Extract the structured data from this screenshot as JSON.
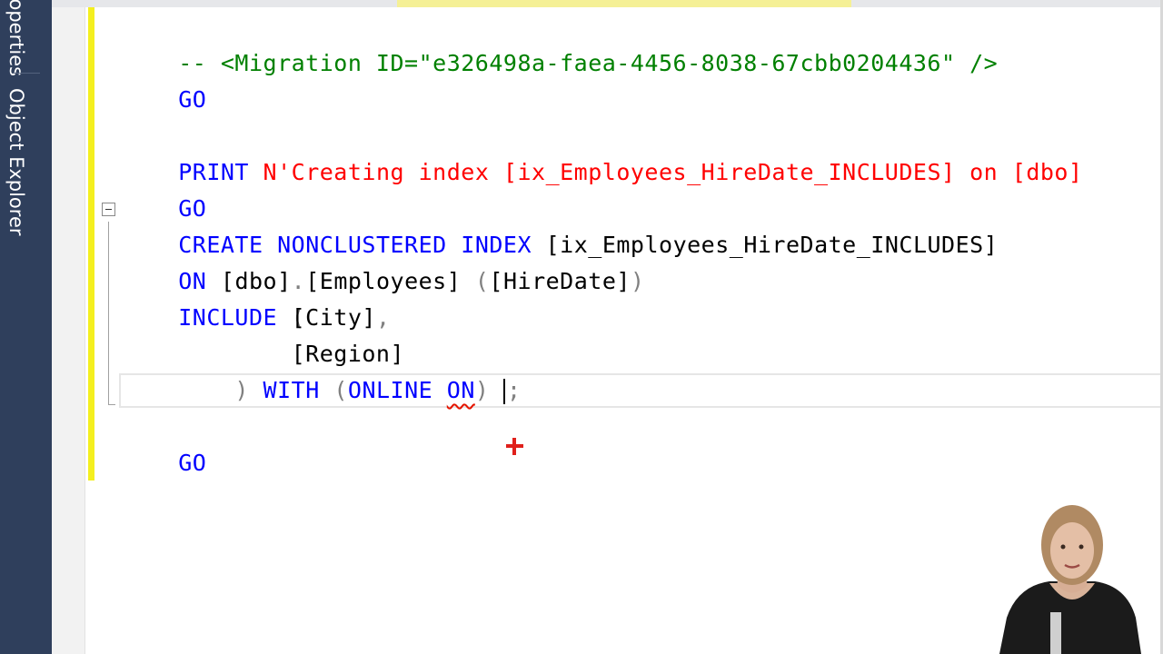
{
  "sidebar": {
    "tabs": [
      {
        "label": "Properties"
      },
      {
        "label": "Object Explorer"
      }
    ]
  },
  "editor": {
    "lines": {
      "l1": {
        "comment": "-- <Migration ID=\"e326498a-faea-4456-8038-67cbb0204436\" />"
      },
      "l2": {
        "go": "GO"
      },
      "l4": {
        "print_kw": "PRINT",
        "print_str": "N'Creating index [ix_Employees_HireDate_INCLUDES] on [dbo]"
      },
      "l5": {
        "go": "GO"
      },
      "l6": {
        "create": "CREATE",
        "nonclustered": "NONCLUSTERED",
        "index": "INDEX",
        "name": "[ix_Employees_HireDate_INCLUDES]"
      },
      "l7": {
        "on": "ON",
        "schema": "[dbo]",
        "dot": ".",
        "table": "[Employees]",
        "open": "(",
        "col": "[HireDate]",
        "close": ")"
      },
      "l8": {
        "include": "INCLUDE",
        "open": "("
      },
      "l9": {
        "col": "[City]",
        "comma": ","
      },
      "l10": {
        "col": "[Region]"
      },
      "l11": {
        "close": ")",
        "with": "WITH",
        "open": "(",
        "online": "ONLINE",
        "on": "ON",
        "close2": ")",
        "semicolon": ";"
      },
      "l12": {
        "go": "GO"
      }
    }
  },
  "colors": {
    "keyword": "#0000ff",
    "string": "#ff0000",
    "comment": "#008000",
    "punctuation": "#808080",
    "change_bar": "#f4ef1f",
    "sidebar": "#2f3f5c"
  },
  "icons": {
    "cursor": "crosshair-cursor-icon",
    "collapse": "outline-collapse-icon"
  }
}
